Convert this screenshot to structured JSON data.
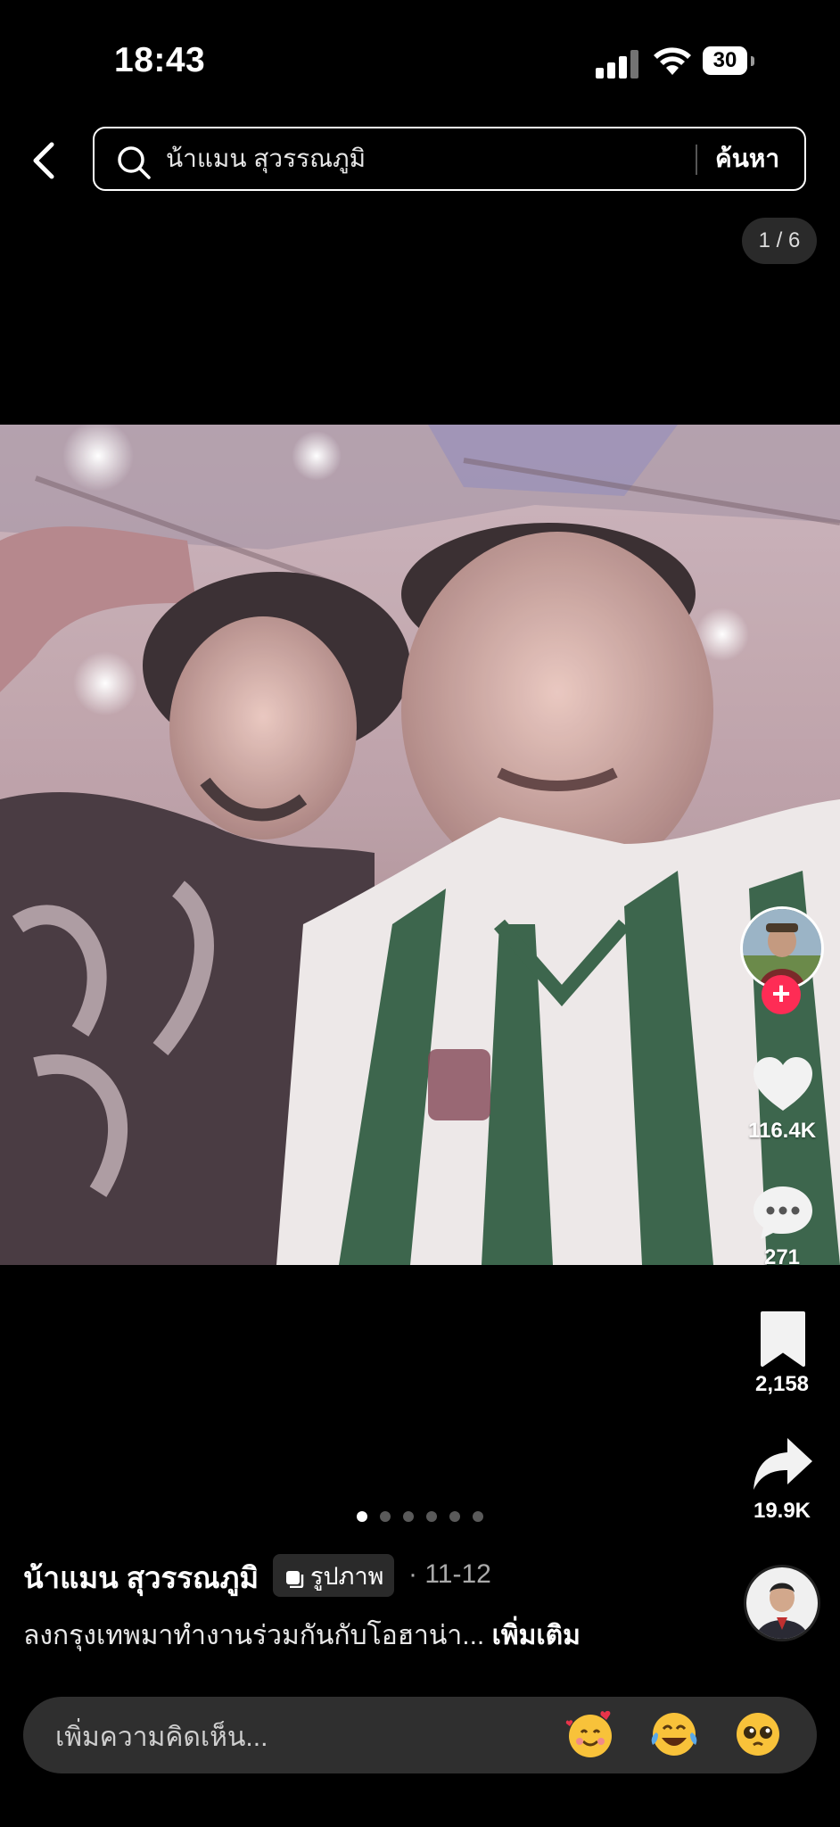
{
  "status_bar": {
    "time": "18:43",
    "battery": "30"
  },
  "search": {
    "query": "น้าแมน สุวรรณภูมิ",
    "button_label": "ค้นหา"
  },
  "photo_counter": "1 / 6",
  "actions": {
    "likes": "116.4K",
    "comments": "271",
    "saves": "2,158",
    "shares": "19.9K"
  },
  "carousel": {
    "total": 6,
    "active": 0
  },
  "post": {
    "author": "น้าแมน สุวรรณภูมิ",
    "type_badge": "รูปภาพ",
    "date": "· 11-12",
    "caption": "ลงกรุงเทพมาทำงานร่วมกันกับโอฮาน่า... ",
    "more_label": "เพิ่มเติม"
  },
  "comment": {
    "placeholder": "เพิ่มความคิดเห็น...",
    "emojis": [
      "🥰",
      "😂",
      "🥺"
    ]
  },
  "colors": {
    "background": "#000000",
    "follow": "#fe2c55",
    "comment_bar": "#2f2f2f"
  },
  "icons": [
    "back-arrow-icon",
    "search-icon",
    "heart-icon",
    "comment-icon",
    "bookmark-icon",
    "share-icon",
    "plus-icon"
  ]
}
